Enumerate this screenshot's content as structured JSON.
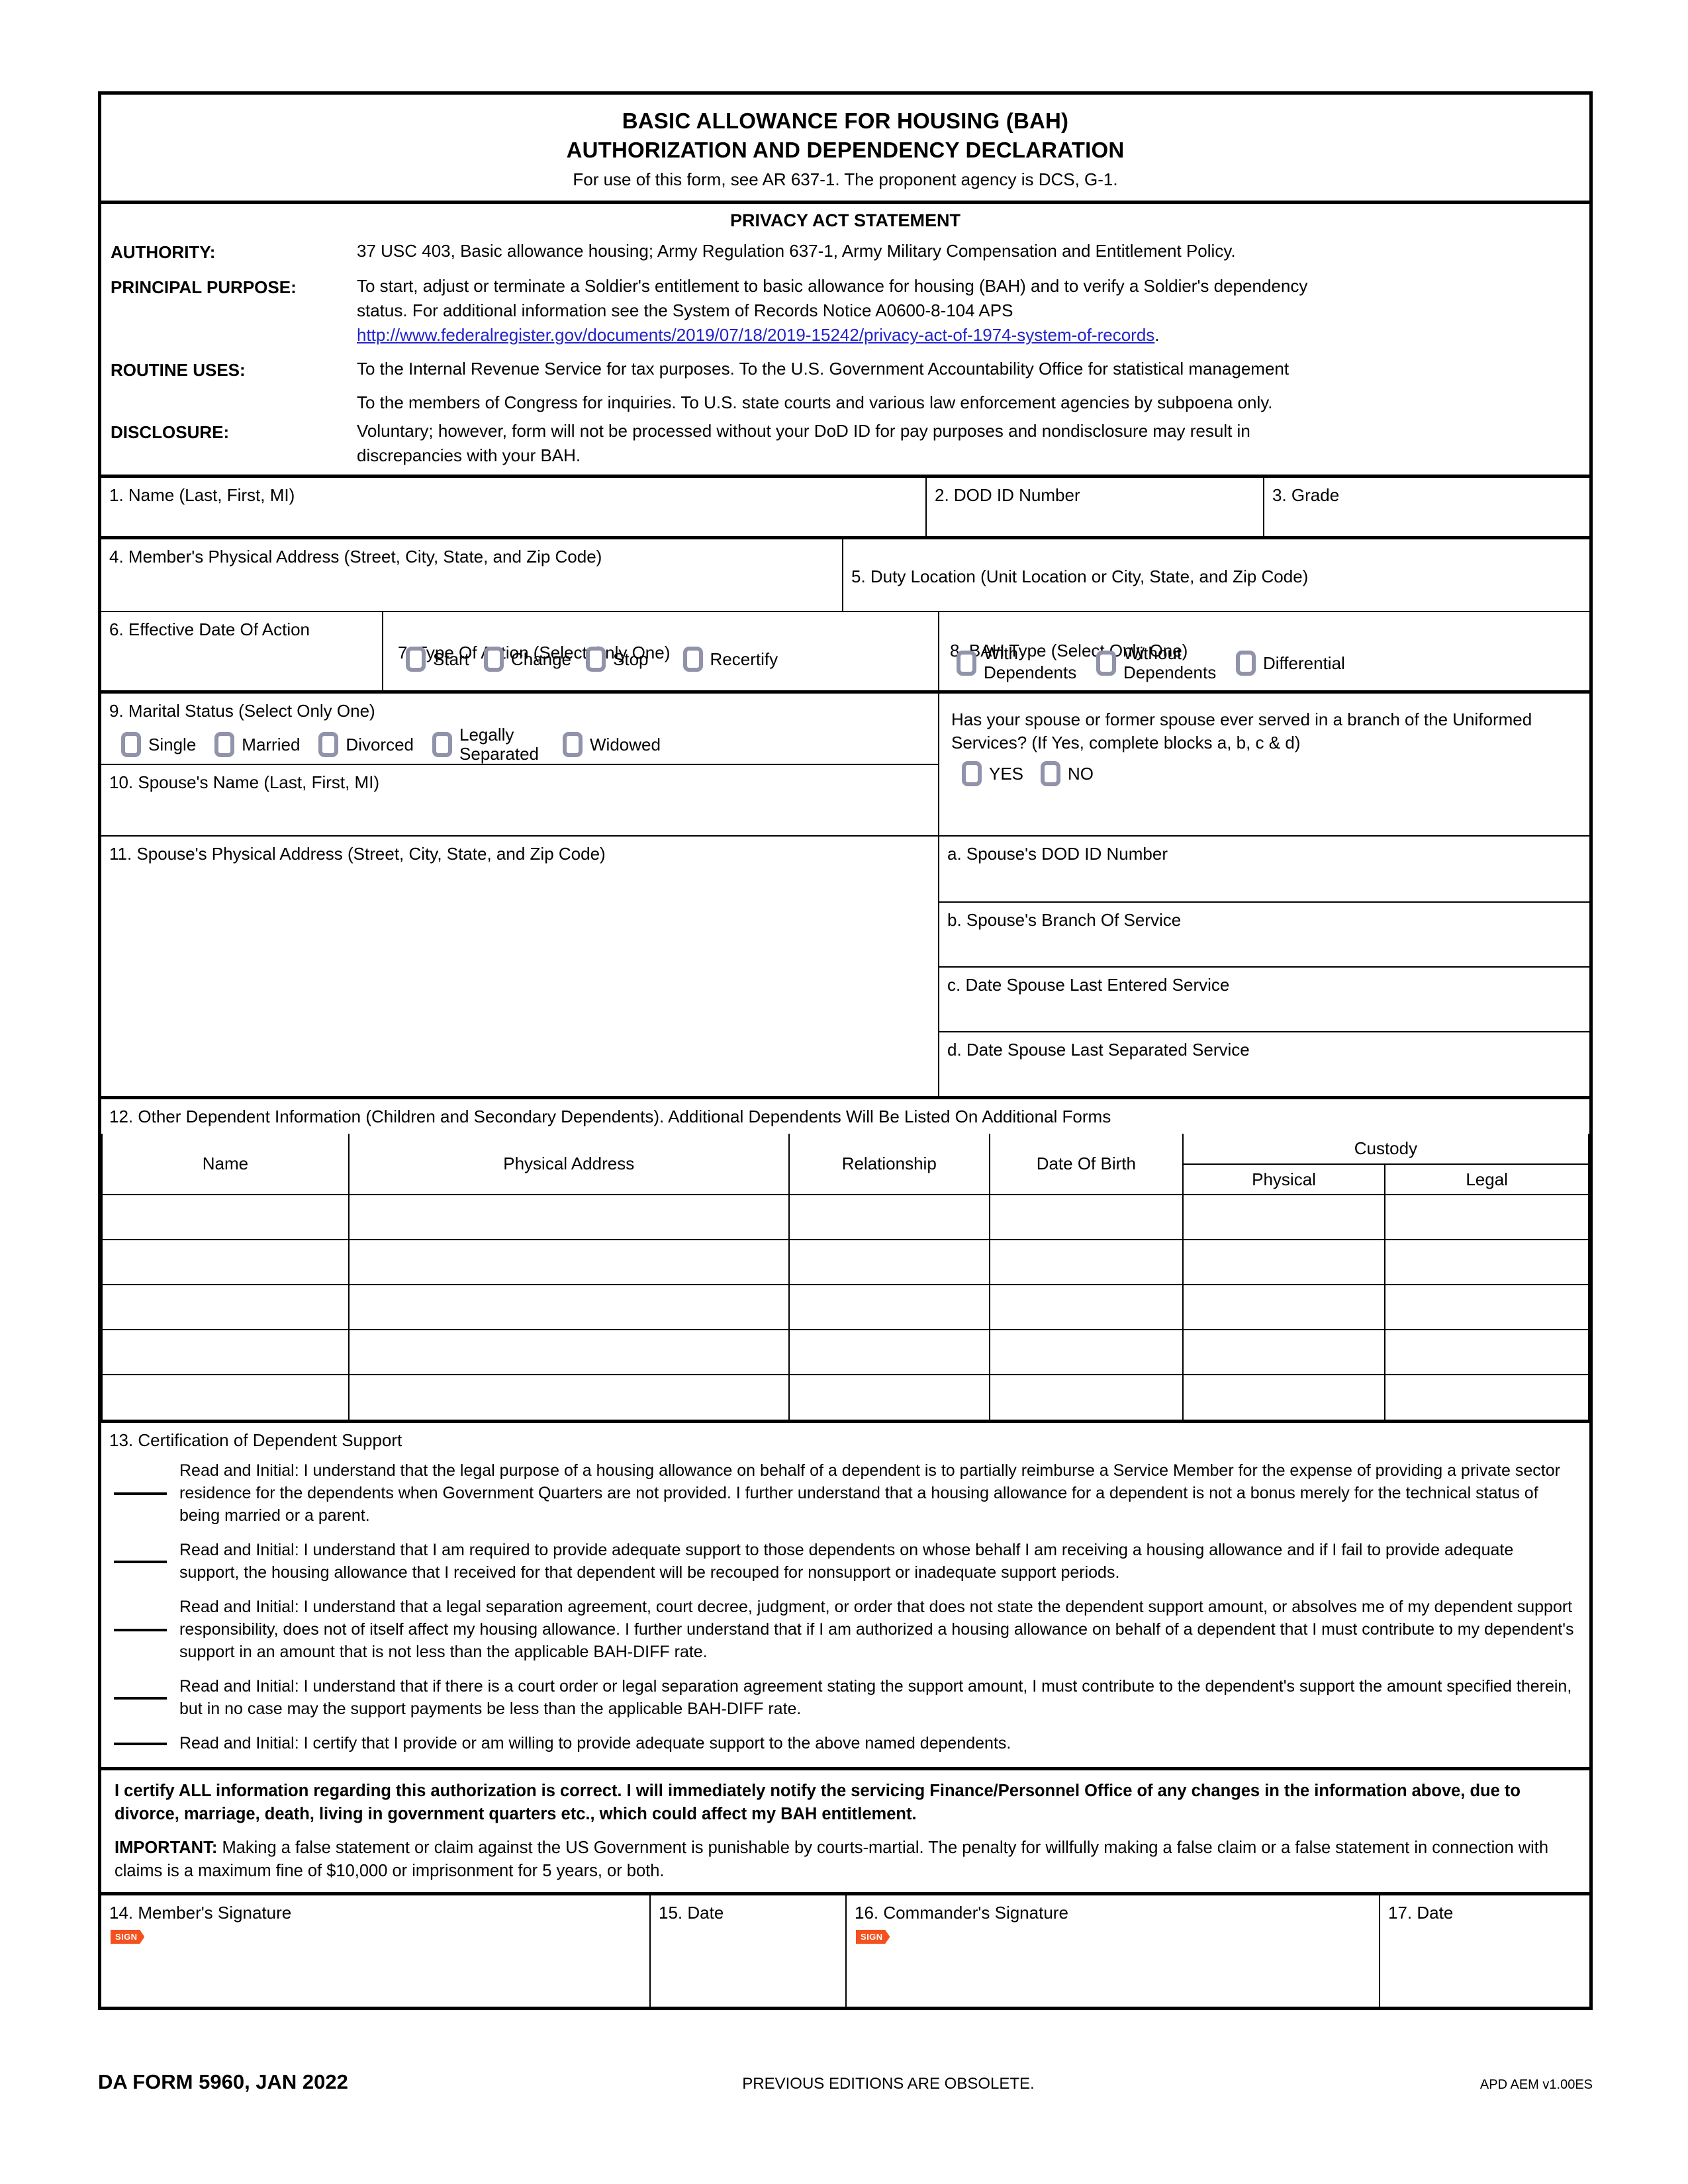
{
  "header": {
    "title_line1": "BASIC ALLOWANCE FOR HOUSING (BAH)",
    "title_line2": "AUTHORIZATION AND DEPENDENCY DECLARATION",
    "subtitle": "For use of this form, see AR 637-1. The proponent agency is DCS, G-1."
  },
  "privacy": {
    "heading": "PRIVACY ACT STATEMENT",
    "authority_label": "AUTHORITY:",
    "authority_text": "37 USC 403, Basic allowance housing;  Army Regulation 637-1, Army Military Compensation and Entitlement Policy.",
    "principal_label": "PRINCIPAL PURPOSE:",
    "principal_text_1": "To start, adjust or terminate a Soldier's entitlement to basic allowance for housing (BAH) and to verify a Soldier's dependency",
    "principal_text_2": "status. For additional information see the System of Records Notice A0600-8-104 APS",
    "principal_link": "http://www.federalregister.gov/documents/2019/07/18/2019-15242/privacy-act-of-1974-system-of-records",
    "principal_link_period": ".",
    "routine_label": "ROUTINE USES:",
    "routine_text_1": "To the Internal Revenue Service for tax purposes. To the U.S. Government Accountability Office for statistical management",
    "routine_text_2": "To the members of Congress for inquiries. To U.S. state courts and various law enforcement agencies by subpoena only.",
    "disclosure_label": "DISCLOSURE:",
    "disclosure_text_1": "Voluntary;  however, form will not be processed without your DoD ID for pay purposes and nondisclosure may result in",
    "disclosure_text_2": "discrepancies with your BAH."
  },
  "fields": {
    "f1_name": "1. Name (Last, First, MI)",
    "f2_dod_id": "2.  DOD ID Number",
    "f3_grade": "3.  Grade",
    "f4_member_address": "4.  Member's Physical Address (Street, City, State, and Zip Code)",
    "f5_duty_location": "5.  Duty Location (Unit Location or City, State, and Zip Code)",
    "f6_effective_date": "6.  Effective Date Of Action",
    "f7_type_of_action": "7.  Type Of Action (Select Only One)",
    "f8_bah_type": "8.  BAH Type (Select Only One)",
    "f9_marital_status": "9.  Marital Status (Select Only One)",
    "f10_spouse_name": "10.  Spouse's Name (Last, First, MI)",
    "f11_spouse_address": "11.  Spouse's Physical Address (Street, City, State, and Zip Code)",
    "fa_spouse_dod_id": "a.  Spouse's DOD ID Number",
    "fb_spouse_branch": "b.  Spouse's Branch Of Service",
    "fc_spouse_entered": "c.  Date Spouse Last Entered Service",
    "fd_spouse_separated": "d.  Date Spouse Last Separated Service",
    "f12_other_dependents": "12.  Other Dependent Information (Children and Secondary Dependents). Additional Dependents Will Be Listed On Additional Forms",
    "f13_certification": "13.  Certification of Dependent Support",
    "f14_member_signature": "14.  Member's Signature",
    "f15_date": "15.  Date",
    "f16_commander_signature": "16.  Commander's Signature",
    "f17_date": "17.  Date"
  },
  "type_of_action_options": [
    "Start",
    "Change",
    "Stop",
    "Recertify"
  ],
  "bah_type_options": [
    "With Dependents",
    "Without Dependents",
    "Differential"
  ],
  "marital_status_options": [
    "Single",
    "Married",
    "Divorced",
    "Legally Separated",
    "Widowed"
  ],
  "spouse_service": {
    "question": "Has your spouse or former spouse ever served in a branch of the Uniformed Services? (If Yes, complete blocks a, b, c & d)",
    "options": [
      "YES",
      "NO"
    ]
  },
  "dependents_table": {
    "columns": [
      "Name",
      "Physical Address",
      "Relationship",
      "Date Of Birth"
    ],
    "custody_group": "Custody",
    "custody_columns": [
      "Physical",
      "Legal"
    ],
    "row_count": 5
  },
  "certification_paragraphs": [
    "Read and Initial: I understand that the legal purpose of a housing allowance on behalf of a dependent is to partially reimburse a Service Member for the expense of providing a private sector residence for the dependents when Government Quarters are not provided. I further understand that a housing allowance for a dependent is not a bonus merely for the technical status of being married or a parent.",
    "Read and Initial: I understand that I am required to provide adequate support to those dependents on whose behalf I am receiving a housing allowance and if I fail to provide adequate support, the housing allowance that I received for that dependent will be recouped for nonsupport or inadequate support periods.",
    "Read and Initial: I understand that a legal separation agreement, court decree, judgment, or order that does not state the dependent support amount, or absolves me of my dependent support responsibility, does not of itself affect my housing allowance. I further understand that if I am authorized a housing allowance on behalf of a dependent that I must contribute to my dependent's support in an amount that is not less than the applicable BAH-DIFF rate.",
    "Read and Initial: I understand that if there is a court order or legal separation agreement stating the support amount, I must contribute to the dependent's support the amount specified therein, but in no case may the support payments be less than the applicable BAH-DIFF rate.",
    "Read and Initial: I certify that I provide or am willing to provide adequate support to the above named dependents."
  ],
  "certify_block": {
    "bold_statement": "I certify ALL information regarding this authorization is correct. I will immediately notify the servicing Finance/Personnel Office of any changes in the information above, due to divorce, marriage, death, living in government quarters etc., which could affect my BAH entitlement.",
    "important_label": "IMPORTANT:",
    "important_text": "Making a false statement or claim against the US Government is punishable by courts-martial. The penalty for willfully making a false claim or a false statement in connection with claims is a maximum fine of $10,000 or imprisonment for 5 years, or both."
  },
  "sign_tag_label": "SIGN",
  "footer": {
    "form_id": "DA FORM 5960, JAN 2022",
    "previous_editions": "PREVIOUS EDITIONS ARE OBSOLETE.",
    "version": "APD AEM v1.00ES"
  },
  "colors": {
    "checkbox_border": "#9193ab",
    "link": "#2222cc",
    "sign_tag_bg": "#f4511e"
  }
}
